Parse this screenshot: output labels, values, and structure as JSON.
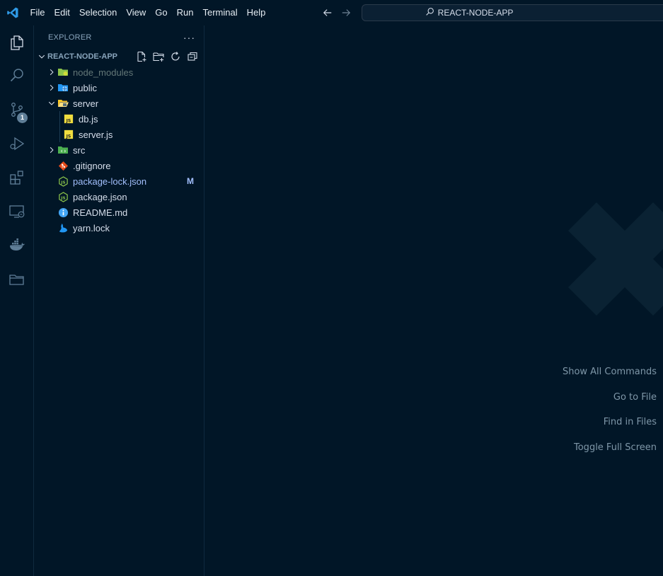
{
  "titlebar": {
    "logo_icon": "vscode-logo-icon",
    "menu": [
      "File",
      "Edit",
      "Selection",
      "View",
      "Go",
      "Run",
      "Terminal",
      "Help"
    ],
    "search_text": "REACT-NODE-APP"
  },
  "activitybar": {
    "items": [
      "explorer-icon",
      "search-icon",
      "source-control-icon",
      "run-debug-icon",
      "extensions-icon",
      "remote-explorer-icon",
      "docker-icon",
      "project-manager-icon"
    ],
    "source_control_badge": "1"
  },
  "sidebar": {
    "title": "EXPLORER",
    "more": "···",
    "section_title": "REACT-NODE-APP",
    "tree": [
      {
        "name": "node_modules",
        "type": "folder",
        "expanded": false,
        "dimmed": true
      },
      {
        "name": "public",
        "type": "folder",
        "expanded": false
      },
      {
        "name": "server",
        "type": "folder",
        "expanded": true
      },
      {
        "name": "db.js",
        "type": "file",
        "indent": 1
      },
      {
        "name": "server.js",
        "type": "file",
        "indent": 1
      },
      {
        "name": "src",
        "type": "folder",
        "expanded": false
      },
      {
        "name": ".gitignore",
        "type": "file"
      },
      {
        "name": "package-lock.json",
        "type": "file",
        "status": "M"
      },
      {
        "name": "package.json",
        "type": "file"
      },
      {
        "name": "README.md",
        "type": "file"
      },
      {
        "name": "yarn.lock",
        "type": "file"
      }
    ]
  },
  "editor": {
    "shortcuts": [
      "Show All Commands",
      "Go to File",
      "Find in Files",
      "Toggle Full Screen"
    ]
  },
  "colors": {
    "background": "#011627",
    "accent": "#a2bffc",
    "js": "#f1dd3f"
  }
}
